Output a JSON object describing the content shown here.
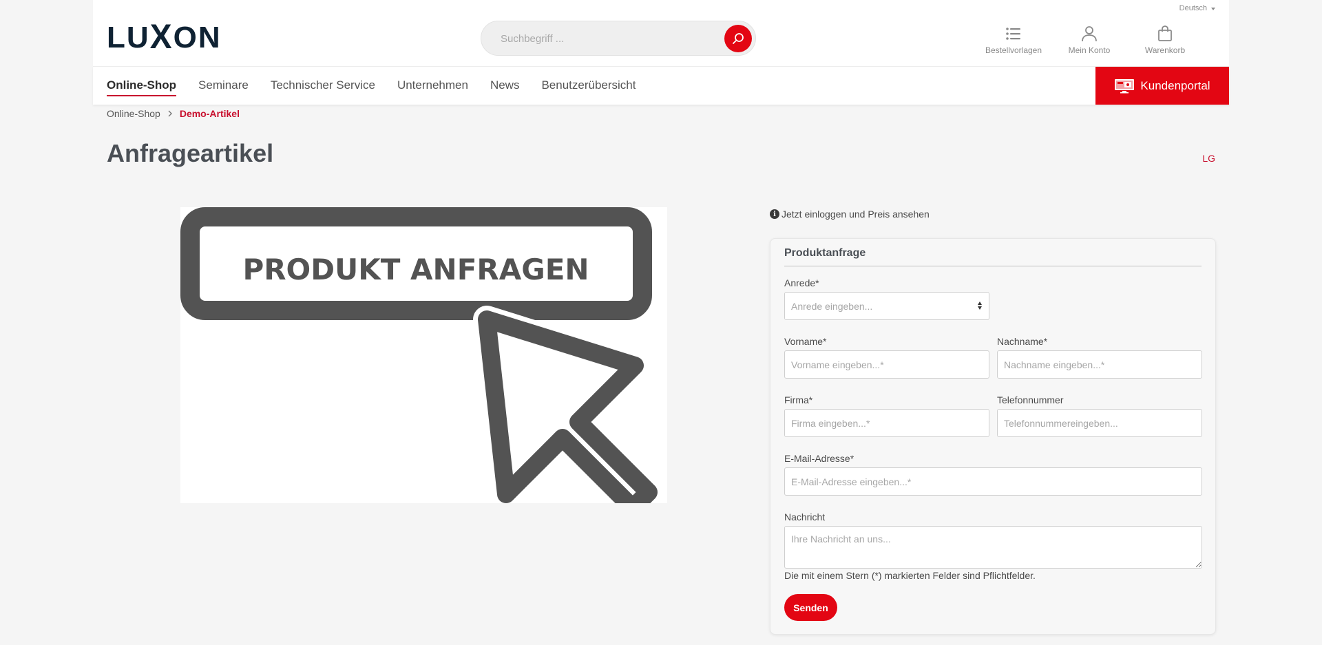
{
  "header": {
    "language": "Deutsch",
    "logo": {
      "left": "LU",
      "x": "X",
      "right": "ON"
    },
    "search_placeholder": "Suchbegriff ...",
    "icons": [
      {
        "label": "Bestellvorlagen",
        "icon": "list-icon"
      },
      {
        "label": "Mein Konto",
        "icon": "user-icon"
      },
      {
        "label": "Warenkorb",
        "icon": "bag-icon"
      }
    ]
  },
  "nav": {
    "items": [
      "Online-Shop",
      "Seminare",
      "Technischer Service",
      "Unternehmen",
      "News",
      "Benutzerübersicht"
    ],
    "active": "Online-Shop",
    "portal_label": "Kundenportal"
  },
  "breadcrumb": [
    "Online-Shop",
    "Demo-Artikel"
  ],
  "page": {
    "title": "Anfrageartikel",
    "brand_link": "LG",
    "image_text": "PRODUKT ANFRAGEN",
    "login_hint": "Jetzt einloggen und Preis ansehen"
  },
  "form": {
    "title": "Produktanfrage",
    "salutation": {
      "label": "Anrede*",
      "placeholder": "Anrede eingeben..."
    },
    "first_name": {
      "label": "Vorname*",
      "placeholder": "Vorname eingeben...*"
    },
    "last_name": {
      "label": "Nachname*",
      "placeholder": "Nachname eingeben...*"
    },
    "company": {
      "label": "Firma*",
      "placeholder": "Firma eingeben...*"
    },
    "phone": {
      "label": "Telefonnummer",
      "placeholder": "Telefonnummereingeben..."
    },
    "email": {
      "label": "E-Mail-Adresse*",
      "placeholder": "E-Mail-Adresse eingeben...*"
    },
    "message": {
      "label": "Nachricht",
      "placeholder": "Ihre Nachricht an uns..."
    },
    "required_note": "Die mit einem Stern (*) markierten Felder sind Pflichtfelder.",
    "submit_label": "Senden"
  },
  "colors": {
    "accent": "#e30613",
    "brand_dark": "#0f2233",
    "text": "#4a4a4a"
  }
}
